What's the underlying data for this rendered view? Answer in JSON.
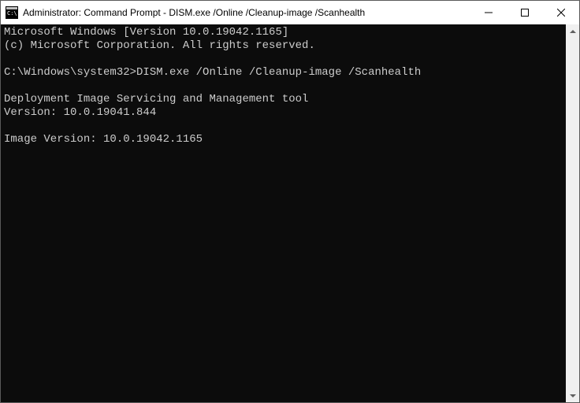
{
  "titlebar": {
    "title": "Administrator: Command Prompt - DISM.exe  /Online /Cleanup-image /Scanhealth"
  },
  "console": {
    "header_line1": "Microsoft Windows [Version 10.0.19042.1165]",
    "header_line2": "(c) Microsoft Corporation. All rights reserved.",
    "prompt": "C:\\Windows\\system32>",
    "command": "DISM.exe /Online /Cleanup-image /Scanhealth",
    "output_line1": "Deployment Image Servicing and Management tool",
    "output_line2": "Version: 10.0.19041.844",
    "output_line3": "Image Version: 10.0.19042.1165"
  },
  "controls": {
    "minimize": "─",
    "maximize": "☐",
    "close": "✕"
  }
}
